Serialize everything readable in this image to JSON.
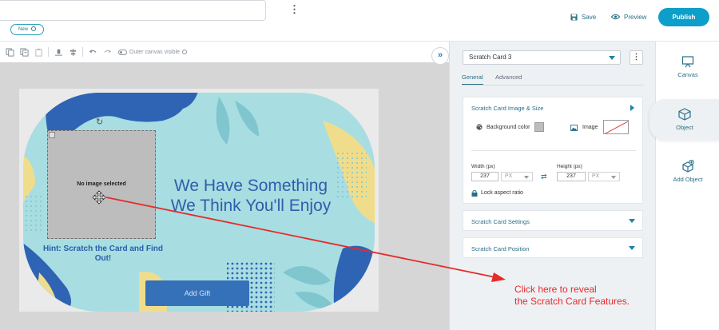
{
  "header": {
    "new_badge": "New",
    "kebab": "⋮",
    "save_label": "Save",
    "preview_label": "Preview",
    "publish_label": "Publish"
  },
  "toolbar": {
    "outer_canvas_label": "Outer canvas visible"
  },
  "canvas": {
    "collapse_icon": "»",
    "no_image_text": "No image selected",
    "rotate_icon": "↻",
    "headline_line1": "We Have Something",
    "headline_line2": "We Think You'll Enjoy",
    "hint_text": "Hint: Scratch the Card and Find Out!",
    "add_gift_label": "Add Gift",
    "colors": {
      "teal_bg": "#a8dde2",
      "blue_shape": "#2f64b4",
      "yellow_shape": "#f0dd8c",
      "headline": "#2f5faa"
    }
  },
  "panel": {
    "object_select_value": "Scratch Card 3",
    "kebab": "⋮",
    "tabs": [
      {
        "label": "General",
        "active": true
      },
      {
        "label": "Advanced",
        "active": false
      }
    ],
    "section_image": {
      "title": "Scratch Card Image & Size",
      "background_color_label": "Background color",
      "image_label": "Image",
      "width_label": "Width (px)",
      "width_value": "237",
      "width_unit": "PX",
      "height_label": "Height (px)",
      "height_value": "237",
      "height_unit": "PX",
      "lock_label": "Lock aspect ratio",
      "swap_icon": "⇄"
    },
    "section_settings_title": "Scratch Card Settings",
    "section_position_title": "Scratch Card Position"
  },
  "rail": {
    "items": [
      {
        "label": "Canvas",
        "icon": "canvas-icon",
        "active": false
      },
      {
        "label": "Object",
        "icon": "cube-icon",
        "active": true
      },
      {
        "label": "Add Object",
        "icon": "add-cube-icon",
        "active": false
      }
    ]
  },
  "annotation": {
    "line1": "Click here to reveal",
    "line2": "the Scratch Card Features.",
    "color": "#e52b2b"
  }
}
